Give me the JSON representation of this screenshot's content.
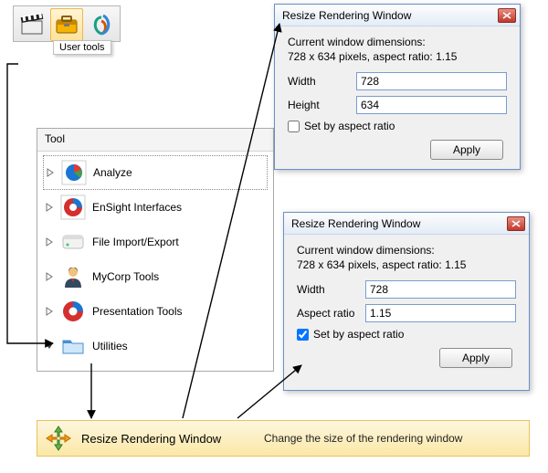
{
  "toolbar": {
    "tooltip": "User tools"
  },
  "tool_panel": {
    "header": "Tool",
    "items": [
      {
        "label": "Analyze",
        "expanded": false,
        "selected": true
      },
      {
        "label": "EnSight Interfaces",
        "expanded": false,
        "selected": false
      },
      {
        "label": "File Import/Export",
        "expanded": false,
        "selected": false
      },
      {
        "label": "MyCorp Tools",
        "expanded": false,
        "selected": false
      },
      {
        "label": "Presentation Tools",
        "expanded": false,
        "selected": false
      },
      {
        "label": "Utilities",
        "expanded": true,
        "selected": false
      }
    ]
  },
  "dialog1": {
    "title": "Resize Rendering Window",
    "current_label": "Current window dimensions:",
    "current_value": "728 x 634 pixels, aspect ratio: 1.15",
    "width_label": "Width",
    "width_value": "728",
    "height_label": "Height",
    "height_value": "634",
    "aspect_chk_label": "Set by aspect ratio",
    "aspect_checked": false,
    "apply_label": "Apply"
  },
  "dialog2": {
    "title": "Resize Rendering Window",
    "current_label": "Current window dimensions:",
    "current_value": "728 x 634 pixels, aspect ratio: 1.15",
    "width_label": "Width",
    "width_value": "728",
    "aspect_label": "Aspect ratio",
    "aspect_value": "1.15",
    "aspect_chk_label": "Set by aspect ratio",
    "aspect_checked": true,
    "apply_label": "Apply"
  },
  "bottom": {
    "name": "Resize Rendering Window",
    "desc": "Change the size of the rendering window"
  }
}
